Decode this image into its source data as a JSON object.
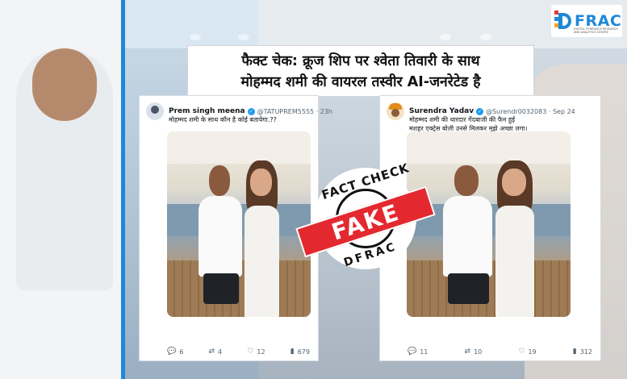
{
  "logo": {
    "text": "FRAC",
    "subtitle": "DIGITAL FORENSICS RESEARCH AND ANALYTICS CENTRE"
  },
  "headline": {
    "line1": "फैक्ट चेक: क्रूज शिप पर श्वेता तिवारी के साथ",
    "line2": "मोहम्मद शमी की वायरल तस्वीर AI-जनरेटेड है"
  },
  "tweets": [
    {
      "name": "Prem singh meena",
      "handle": "@TATUPREM5555 · 23h",
      "text_lines": [
        "मोहम्मद शमी के साथ कौन है कोई बतायेगा.??"
      ],
      "stats": {
        "replies": "6",
        "retweets": "4",
        "likes": "12",
        "views": "679"
      }
    },
    {
      "name": "Surendra Yadav",
      "handle": "@Surendr0032083 · Sep 24",
      "text_lines": [
        "मोहम्मद शमी की धारदार गेंदबाजी की फैन हुई",
        "मशहूर एक्ट्रेस बोली उनसे मिलकर मुझे अच्छा लगा।"
      ],
      "stats": {
        "replies": "11",
        "retweets": "10",
        "likes": "19",
        "views": "312"
      }
    }
  ],
  "stamp": {
    "top": "FACT CHECK",
    "center": "FAKE",
    "bottom": "DFRAC"
  },
  "colors": {
    "accent_blue": "#1e88d8",
    "stamp_red": "#e3292f",
    "verified": "#1d9bf0"
  }
}
